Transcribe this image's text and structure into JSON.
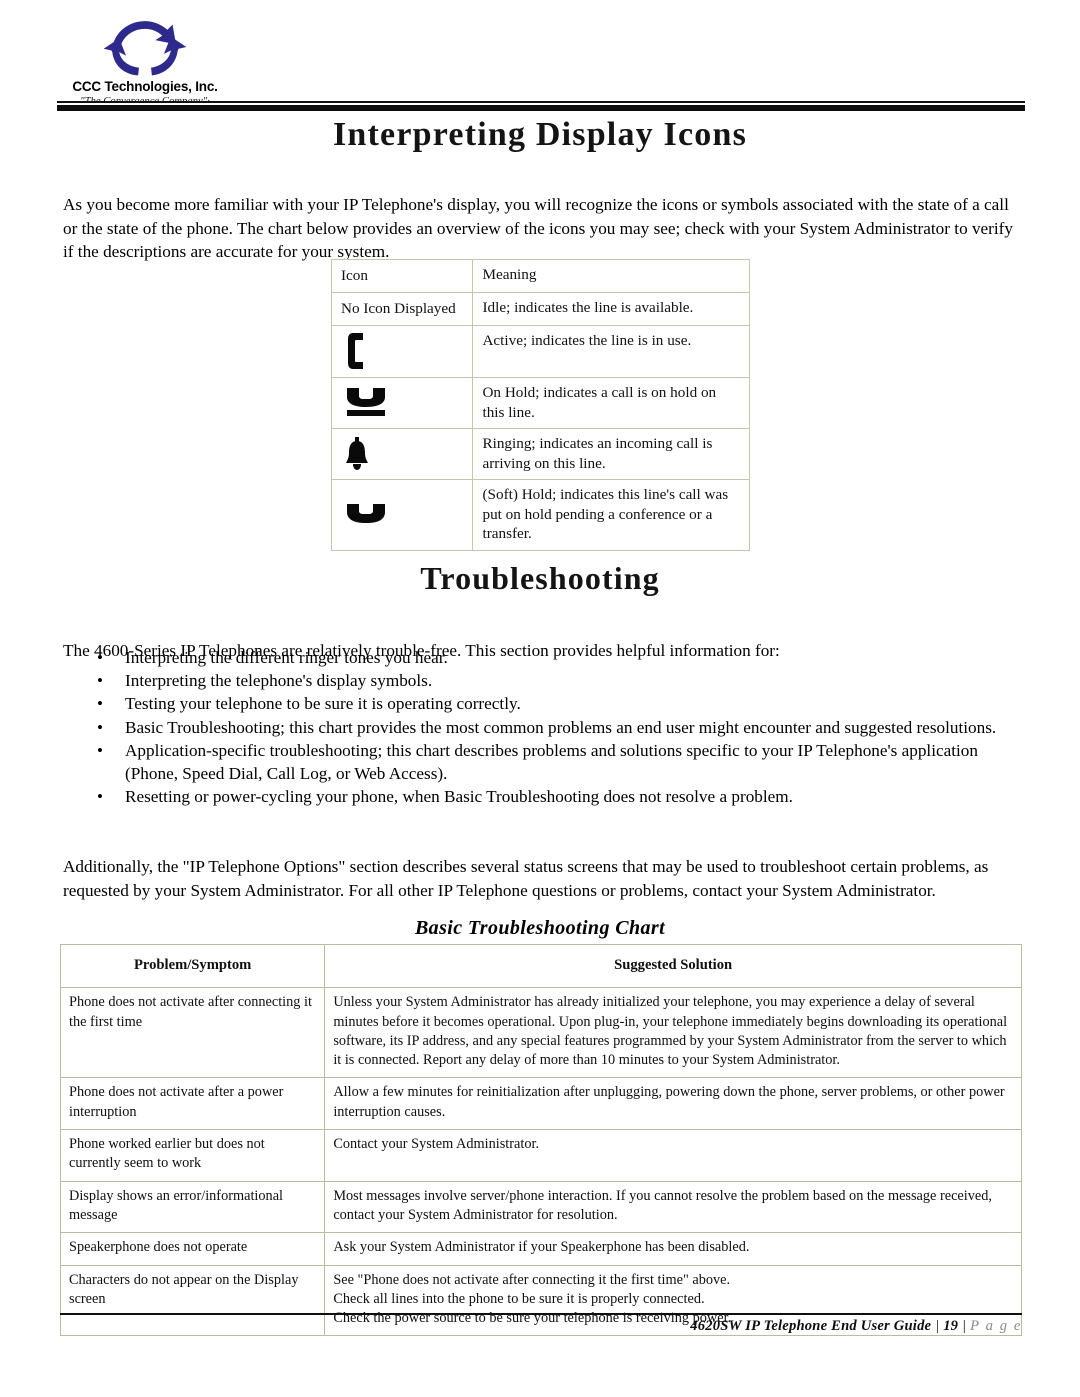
{
  "logo": {
    "icon": "circular-arrows-logo",
    "company": "CCC Technologies, Inc.",
    "tagline": "\"The Convergence Company\"·"
  },
  "doc": {
    "title": "Interpreting Display Icons",
    "intro": "As you become more familiar with your IP Telephone's display, you will recognize the icons or symbols associated with the state of a call or the state of the phone. The chart below provides an overview of the icons you may see; check with your System Administrator to verify if the descriptions are accurate for your system."
  },
  "icon_table": {
    "headers": {
      "icon": "Icon",
      "meaning": "Meaning"
    },
    "rows": [
      {
        "icon_text": "No Icon Displayed",
        "icon_glyph": "",
        "meaning": "Idle; indicates the line is available."
      },
      {
        "icon_text": "",
        "icon_glyph": "handset-vertical-icon",
        "meaning": "Active; indicates the line is in use."
      },
      {
        "icon_text": "",
        "icon_glyph": "handset-on-hold-icon",
        "meaning": "On Hold; indicates a call is on hold on this line."
      },
      {
        "icon_text": "",
        "icon_glyph": "bell-ringing-icon",
        "meaning": "Ringing; indicates an incoming call is arriving on this line."
      },
      {
        "icon_text": "",
        "icon_glyph": "handset-cradle-icon",
        "meaning": "(Soft) Hold; indicates this line's call was put on hold pending a conference or a transfer."
      }
    ]
  },
  "troubleshooting": {
    "title": "Troubleshooting",
    "lead": "The 4600-Series IP Telephones are relatively trouble-free. This section provides helpful information for:",
    "bullet_char": "•",
    "bullets": [
      "Interpreting the different ringer tones you hear.",
      "Interpreting the telephone's display symbols.",
      "Testing your telephone to be sure it is operating correctly.",
      "Basic Troubleshooting; this chart provides the most common problems an end user might encounter and suggested resolutions.",
      "Application-specific troubleshooting; this chart describes problems and solutions specific to your IP Telephone's application (Phone, Speed Dial, Call Log, or Web Access).",
      "Resetting or power-cycling your phone, when Basic Troubleshooting does not resolve a problem."
    ],
    "additional": "Additionally, the \"IP Telephone Options\" section describes several status screens that may be used to troubleshoot certain problems, as requested by your System Administrator. For all other IP Telephone questions or problems, contact your System Administrator.",
    "chart_caption": "Basic Troubleshooting Chart",
    "chart_headers": {
      "problem": "Problem/Symptom",
      "solution": "Suggested Solution"
    },
    "chart_rows": [
      {
        "problem": "Phone does not activate after connecting it the first time",
        "solution_lines": [
          "Unless your System Administrator has already initialized your telephone, you may experience a delay of several minutes before it becomes operational. Upon plug-in, your telephone immediately begins downloading its operational software, its IP address, and any special features programmed by your System Administrator from the server to which it is connected. Report any delay of more than 10 minutes to your System Administrator."
        ]
      },
      {
        "problem": "Phone does not activate after a power interruption",
        "solution_lines": [
          "Allow a few minutes for reinitialization after unplugging, powering down the phone, server problems, or other power interruption causes."
        ]
      },
      {
        "problem": "Phone worked earlier but does not currently seem to work",
        "solution_lines": [
          "Contact your System Administrator."
        ]
      },
      {
        "problem": "Display shows an error/informational message",
        "solution_lines": [
          "Most messages involve server/phone interaction. If you cannot resolve the problem based on the message received, contact your System Administrator for resolution."
        ]
      },
      {
        "problem": "Speakerphone does not operate",
        "solution_lines": [
          "Ask your System Administrator if your Speakerphone has been disabled."
        ]
      },
      {
        "problem": "Characters do not appear on the Display screen",
        "solution_lines": [
          "See \"Phone does not activate after connecting it the first time\" above.",
          "Check all lines into the phone to be sure it is properly connected.",
          "Check the power source to be sure your telephone is receiving power."
        ]
      }
    ]
  },
  "footer": {
    "guide": "4620SW IP Telephone End User Guide",
    "sep1": "|",
    "page_number": "19",
    "sep2": "|",
    "page_label": "P a g e"
  },
  "colors": {
    "logo_blue": "#2d2a8c",
    "table_border": "#c9c5ad",
    "rule_black": "#0d0d0d",
    "page_label_gray": "#8a8a8a"
  }
}
